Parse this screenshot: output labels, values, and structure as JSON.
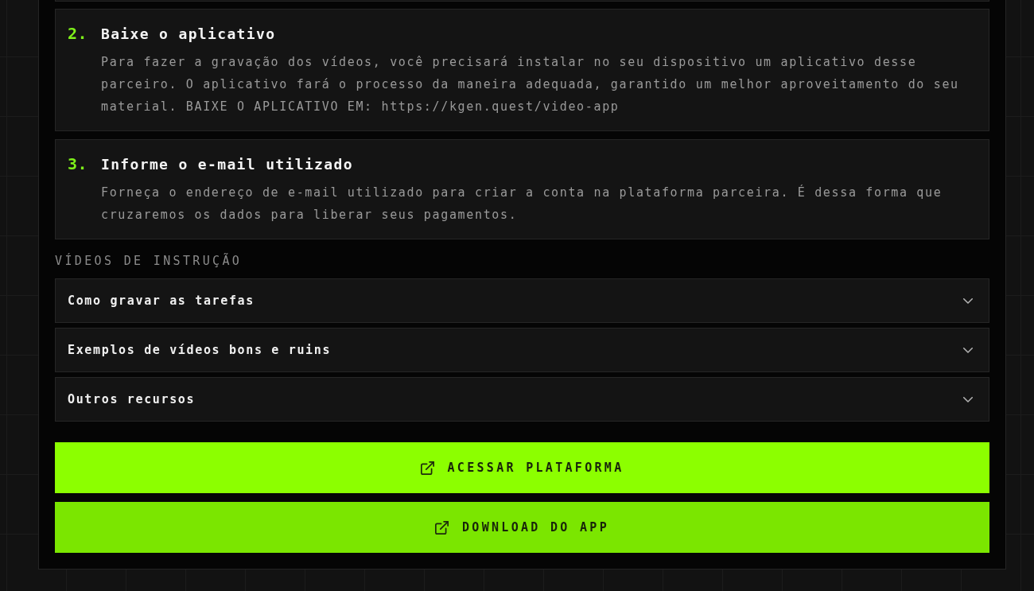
{
  "steps": [
    {
      "number": "2.",
      "title": "Baixe o aplicativo",
      "description": "Para fazer a gravação dos vídeos, você precisará instalar no seu dispositivo um aplicativo desse parceiro. O aplicativo fará o processo da maneira adequada, garantido um melhor aproveitamento do seu material. BAIXE O APLICATIVO EM: https://kgen.quest/video-app"
    },
    {
      "number": "3.",
      "title": "Informe o e-mail utilizado",
      "description": "Forneça o endereço de e-mail utilizado para criar a conta na plataforma parceira. É dessa forma que cruzaremos os dados para liberar seus pagamentos."
    }
  ],
  "videos_section": {
    "heading": "VÍDEOS DE INSTRUÇÃO",
    "items": [
      {
        "label": "Como gravar as tarefas",
        "expanded": false
      },
      {
        "label": "Exemplos de vídeos bons e ruins",
        "expanded": false
      },
      {
        "label": "Outros recursos",
        "expanded": false
      }
    ]
  },
  "buttons": [
    {
      "label": "ACESSAR PLATAFORMA",
      "kind": "primary"
    },
    {
      "label": "DOWNLOAD DO APP",
      "kind": "secondary"
    }
  ]
}
